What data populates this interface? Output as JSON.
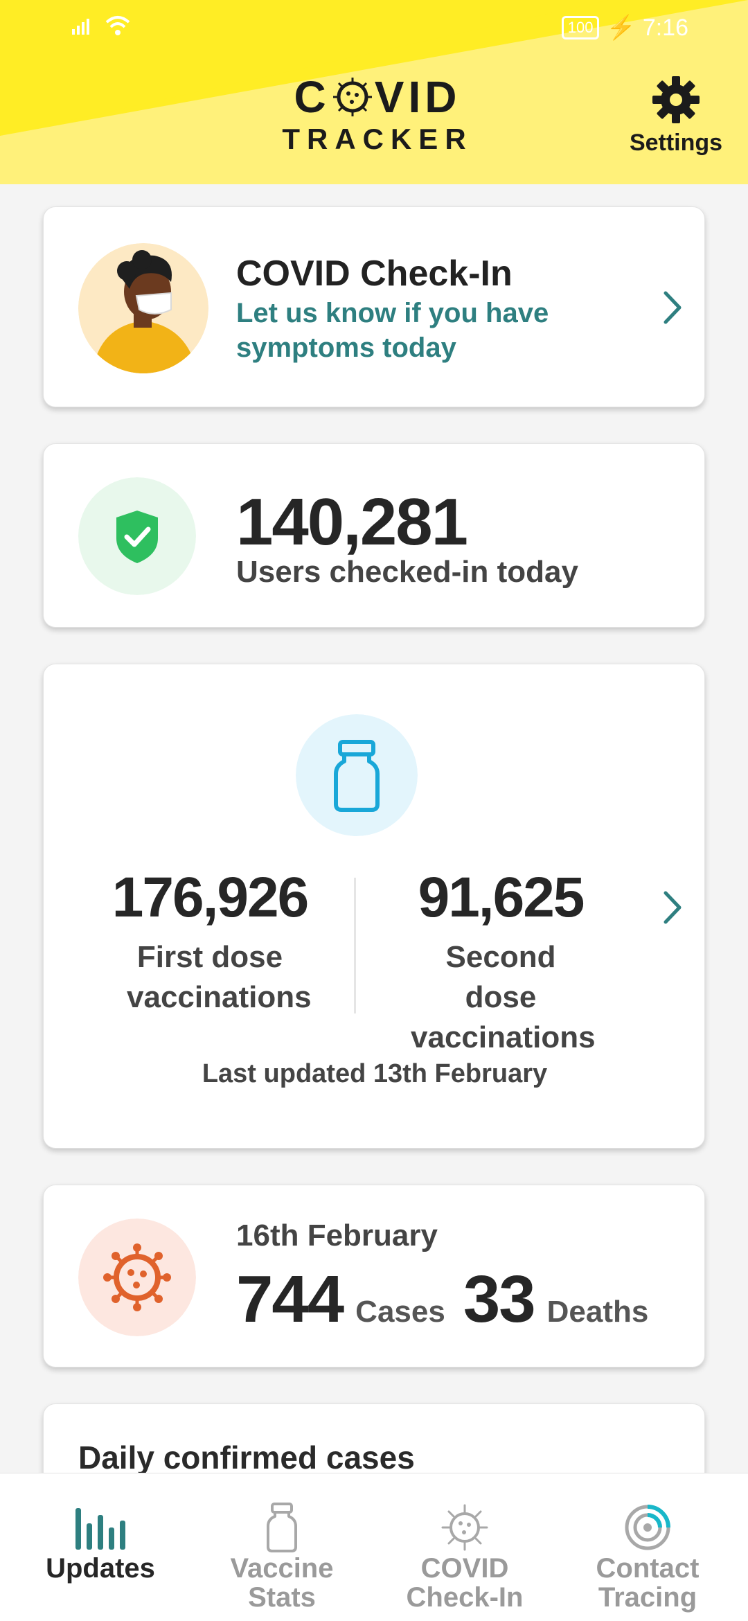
{
  "status_bar": {
    "time": "7:16",
    "battery": "100"
  },
  "header": {
    "logo_line1_left": "C",
    "logo_line1_right": "VID",
    "logo_line2": "TRACKER",
    "settings_label": "Settings"
  },
  "checkin_card": {
    "title": "COVID Check-In",
    "subtitle": "Let us know if you have symptoms today"
  },
  "users_card": {
    "count": "140,281",
    "label": "Users checked-in today"
  },
  "vaccine_card": {
    "first_dose_count": "176,926",
    "first_dose_label": "First dose vaccinations",
    "second_dose_count": "91,625",
    "second_dose_label": "Second dose vaccinations",
    "last_updated": "Last updated 13th February"
  },
  "cases_card": {
    "date": "16th February",
    "cases_count": "744",
    "cases_label": "Cases",
    "deaths_count": "33",
    "deaths_label": "Deaths"
  },
  "daily_card": {
    "title": "Daily confirmed cases"
  },
  "bottom_nav": {
    "items": [
      {
        "label_line1": "Updates",
        "label_line2": "",
        "active": true
      },
      {
        "label_line1": "Vaccine",
        "label_line2": "Stats",
        "active": false
      },
      {
        "label_line1": "COVID",
        "label_line2": "Check-In",
        "active": false
      },
      {
        "label_line1": "Contact",
        "label_line2": "Tracing",
        "active": false
      }
    ]
  },
  "colors": {
    "header_yellow": "#fff17a",
    "header_bright_yellow": "#ffed25",
    "teal": "#2e7f80",
    "green_shield": "#2ebf5f",
    "vaccine_blue": "#19a7d8",
    "virus_orange": "#e0622c"
  }
}
